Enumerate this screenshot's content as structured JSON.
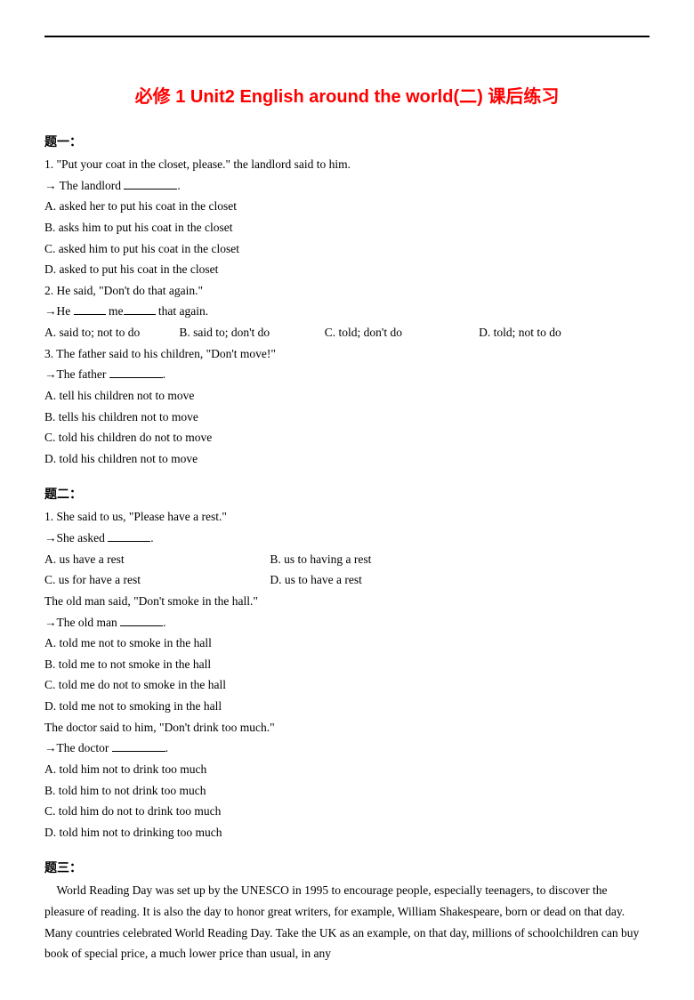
{
  "title": "必修 1 Unit2 English around the world(二) 课后练习",
  "section1": {
    "label": "题一：",
    "q1": {
      "prompt": "1. \"Put your coat in the closet, please.\" the landlord said to him.",
      "arrow": "→ The landlord ",
      "A": "A. asked her to put his coat in the closet",
      "B": "B. asks him to put his coat in the closet",
      "C": "C. asked him to put his coat in the closet",
      "D": "D. asked to put his coat in the closet"
    },
    "q2": {
      "prompt": "2. He said, \"Don't do that again.\"",
      "arrow_a": "→He ",
      "arrow_b": " me",
      "arrow_c": " that again.",
      "A": "A. said to; not to do",
      "B": "B. said to; don't do",
      "C": "C. told; don't do",
      "D": "D. told; not to do"
    },
    "q3": {
      "prompt": "3. The father said to his children, \"Don't move!\"",
      "arrow": "→The father ",
      "A": "A. tell his children not to move",
      "B": "B. tells his children not to move",
      "C": "C. told his children do not to move",
      "D": "D. told his children not to move"
    }
  },
  "section2": {
    "label": "题二：",
    "q1": {
      "prompt": "1. She said to us, \"Please have a rest.\"",
      "arrow": "→She asked ",
      "A": "A. us have a rest",
      "B": "B. us to having a rest",
      "C": "C. us for have a rest",
      "D": "D. us to have a rest"
    },
    "q2": {
      "prompt": "The old man said, \"Don't smoke in the hall.\"",
      "arrow": "→The old man ",
      "A": "A. told me not to smoke in the hall",
      "B": "B. told me to not smoke in the hall",
      "C": "C. told me do not to smoke in the hall",
      "D": "D. told me not to smoking in the hall"
    },
    "q3": {
      "prompt": "The doctor said to him, \"Don't drink too much.\"",
      "arrow": "→The doctor ",
      "A": "A. told him not to drink too much",
      "B": "B. told him to not drink too much",
      "C": "C. told him do not to drink too much",
      "D": "D. told him not to drinking too much"
    }
  },
  "section3": {
    "label": "题三：",
    "p1": "    World Reading Day was set up by the UNESCO in 1995 to encourage people, especially teenagers, to discover the pleasure of reading. It is also the day to honor great writers, for example, William Shakespeare, born or dead on that day.",
    "p2": "Many countries celebrated World Reading Day. Take the UK as an example, on that day, millions of schoolchildren can buy book of special price, a much lower price than usual, in any"
  }
}
